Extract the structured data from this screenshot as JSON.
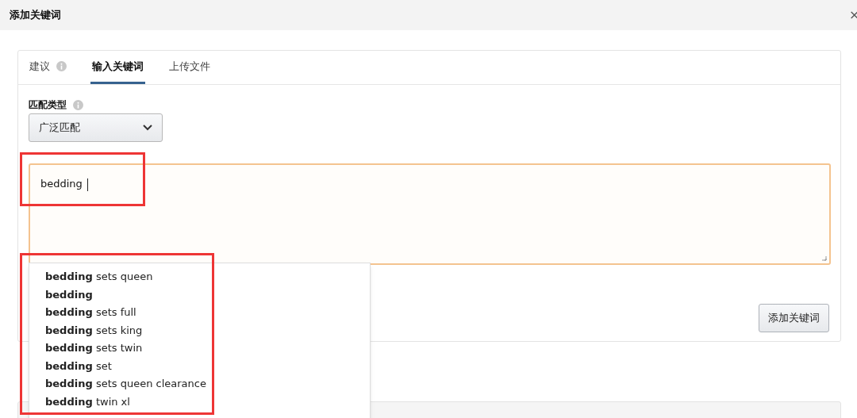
{
  "dialog": {
    "title": "添加关键词",
    "close": "×"
  },
  "tabs": [
    {
      "label": "建议",
      "info": true,
      "selected": false
    },
    {
      "label": "输入关键词",
      "info": false,
      "selected": true
    },
    {
      "label": "上传文件",
      "info": false,
      "selected": false
    }
  ],
  "match_type": {
    "label": "匹配类型",
    "value": "广泛匹配"
  },
  "keyword_input": {
    "value": "bedding",
    "focused": true
  },
  "suggestions": [
    "**bedding** sets queen",
    "**bedding**",
    "**bedding** sets full",
    "**bedding** sets king",
    "**bedding** sets twin",
    "**bedding** set",
    "**bedding** sets queen clearance",
    "**bedding** twin xl"
  ],
  "add_button": "添加关键词"
}
